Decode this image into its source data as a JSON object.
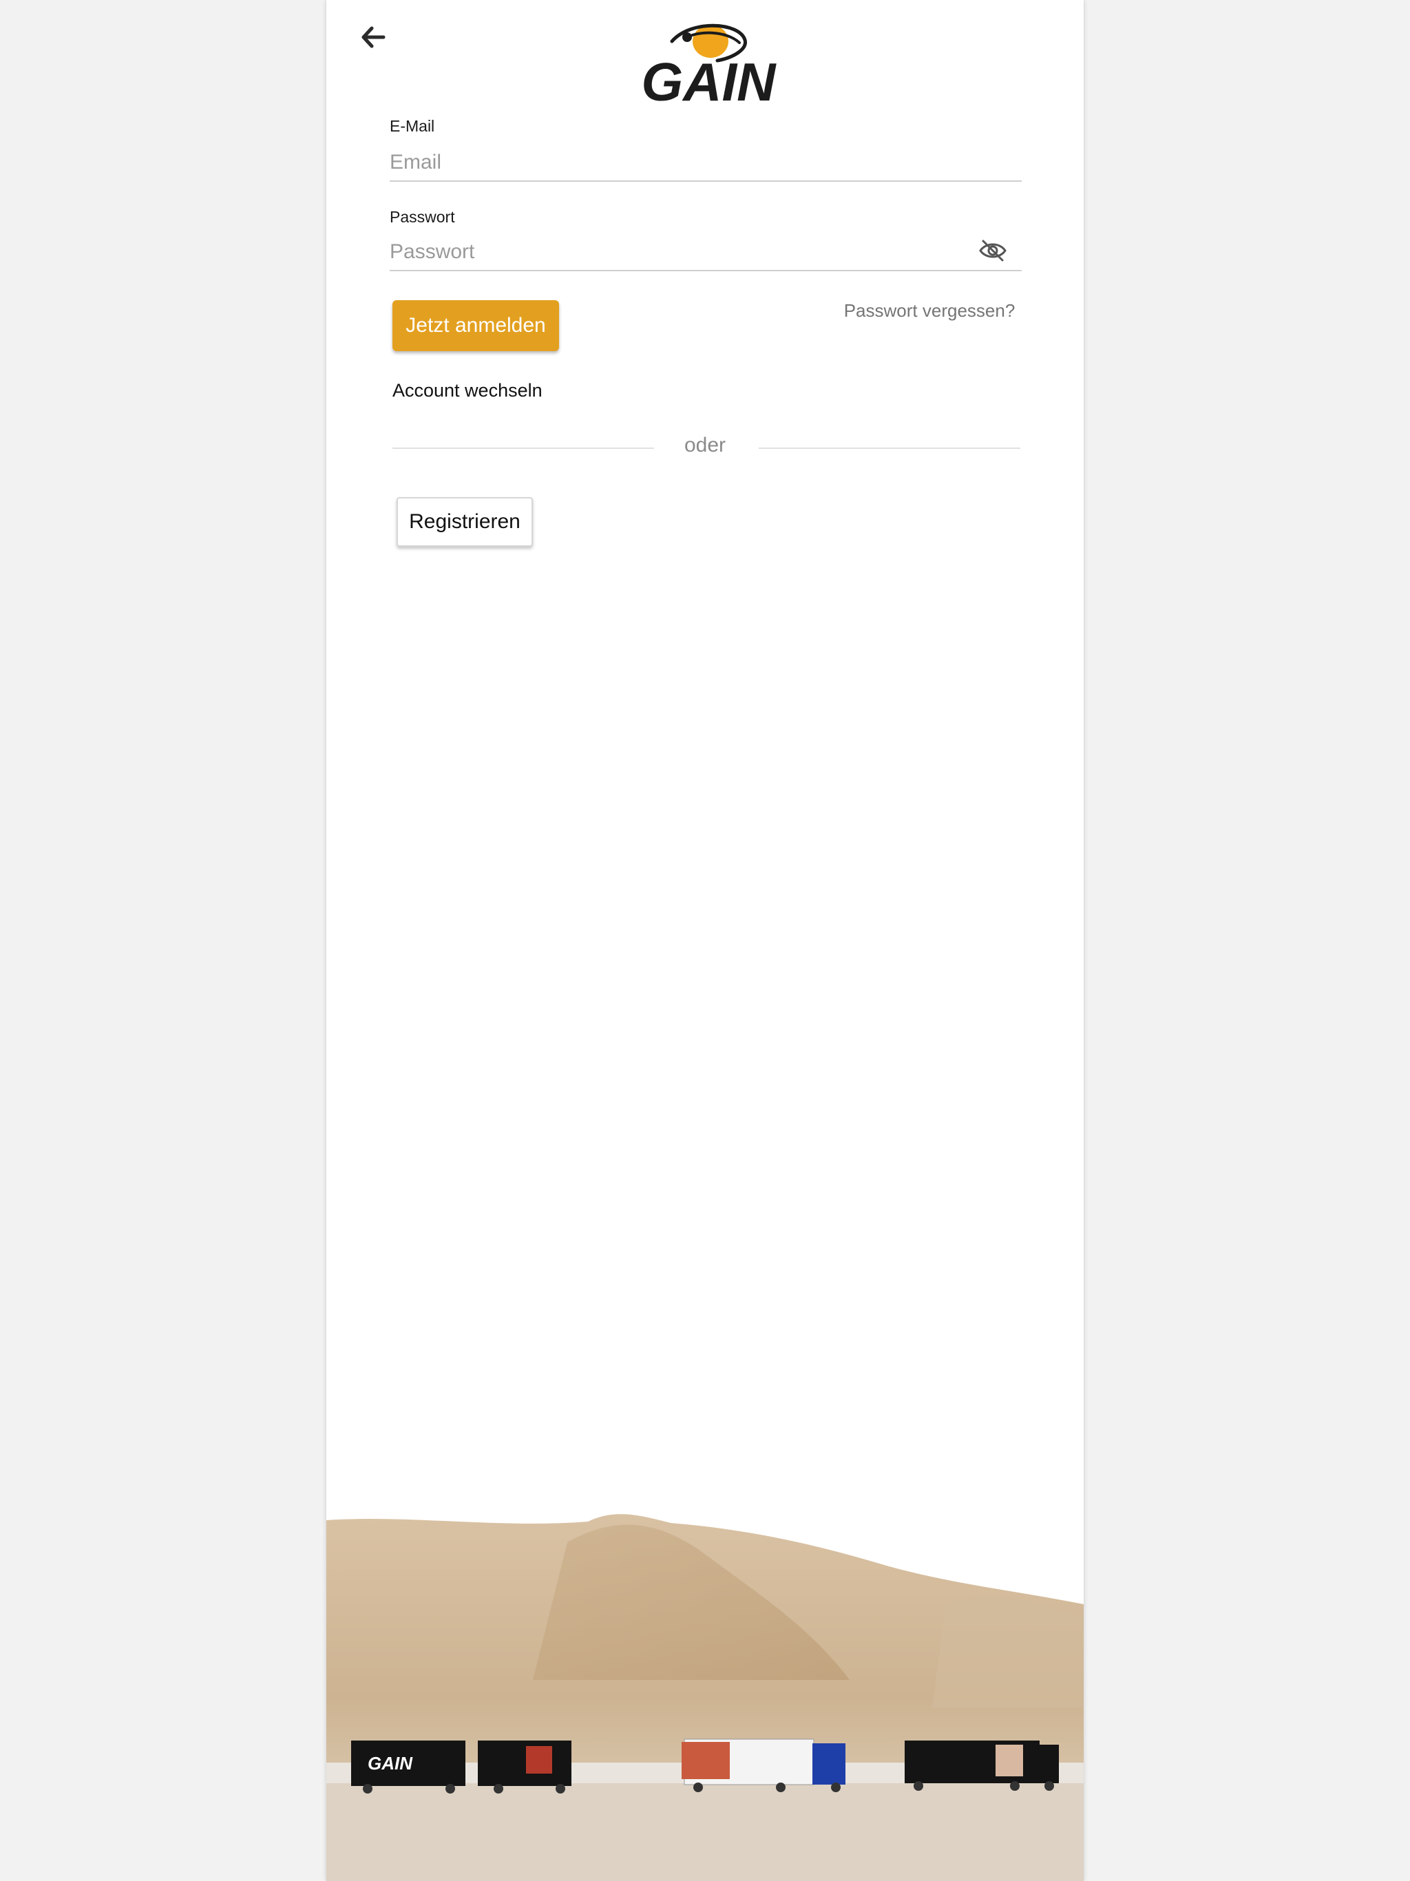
{
  "header": {
    "back_icon": "arrow-left-icon",
    "logo_text": "GAIN"
  },
  "form": {
    "email_label": "E-Mail",
    "email_placeholder": "Email",
    "password_label": "Passwort",
    "password_placeholder": "Passwort",
    "password_toggle_icon": "eye-off-icon",
    "login_button": "Jetzt anmelden",
    "forgot_link": "Passwort vergessen?",
    "switch_account": "Account wechseln",
    "divider_text": "oder",
    "register_button": "Registrieren"
  },
  "footer_image": {
    "truck_logo_text": "GAIN"
  },
  "colors": {
    "accent": "#e3a020",
    "logo_dark": "#1c1c1c"
  }
}
